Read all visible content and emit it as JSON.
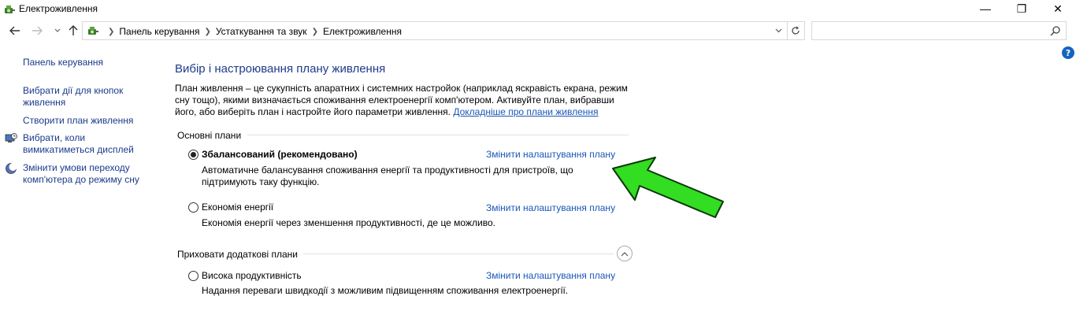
{
  "window": {
    "title": "Електроживлення",
    "minimize_glyph": "—",
    "maximize_glyph": "❐",
    "close_glyph": "✕"
  },
  "navigation": {
    "back_icon": "arrow-left-icon",
    "forward_icon": "arrow-right-icon",
    "recent_icon": "chevron-down-icon",
    "up_icon": "arrow-up-icon",
    "breadcrumbs": [
      "Панель керування",
      "Устаткування та звук",
      "Електроживлення"
    ],
    "search_placeholder": ""
  },
  "sidebar": {
    "home_link": "Панель керування",
    "links": [
      {
        "label": "Вибрати дії для кнопок живлення",
        "icon": ""
      },
      {
        "label": "Створити план живлення",
        "icon": ""
      },
      {
        "label": "Вибрати, коли вимикатиметься дисплей",
        "icon": "display-timer-icon"
      },
      {
        "label": "Змінити умови переходу комп'ютера до режиму сну",
        "icon": "moon-sleep-icon"
      }
    ]
  },
  "main": {
    "title": "Вибір і настроювання плану живлення",
    "description": "План живлення – це сукупність апаратних і системних настройок (наприклад яскравість екрана, режим сну тощо), якими визначається споживання електроенергії комп'ютером. Активуйте план, вибравши його, або виберіть план і настройте його параметри живлення. ",
    "description_link": "Докладніше про плани живлення",
    "primary_group": {
      "header": "Основні плани",
      "plans": [
        {
          "name": "Збалансований (рекомендовано)",
          "selected": true,
          "description": "Автоматичне балансування споживання енергії та продуктивності для пристроїв, що підтримують таку функцію.",
          "link": "Змінити налаштування плану"
        },
        {
          "name": "Економія енергії",
          "selected": false,
          "description": "Економія енергії через зменшення продуктивності, де це можливо.",
          "link": "Змінити налаштування плану"
        }
      ]
    },
    "extra_group": {
      "header": "Приховати додаткові плани",
      "collapse_icon": "chevron-up-icon",
      "plans": [
        {
          "name": "Висока продуктивність",
          "selected": false,
          "description": "Надання переваги швидкодії з можливим підвищенням споживання електроенергії.",
          "link": "Змінити налаштування плану"
        }
      ]
    }
  },
  "help": {
    "label": "?"
  },
  "colors": {
    "link": "#1a56b8",
    "title": "#1e3a8a",
    "sidebar_link": "#1a3a8a",
    "annotation_arrow": "#33dd22"
  }
}
